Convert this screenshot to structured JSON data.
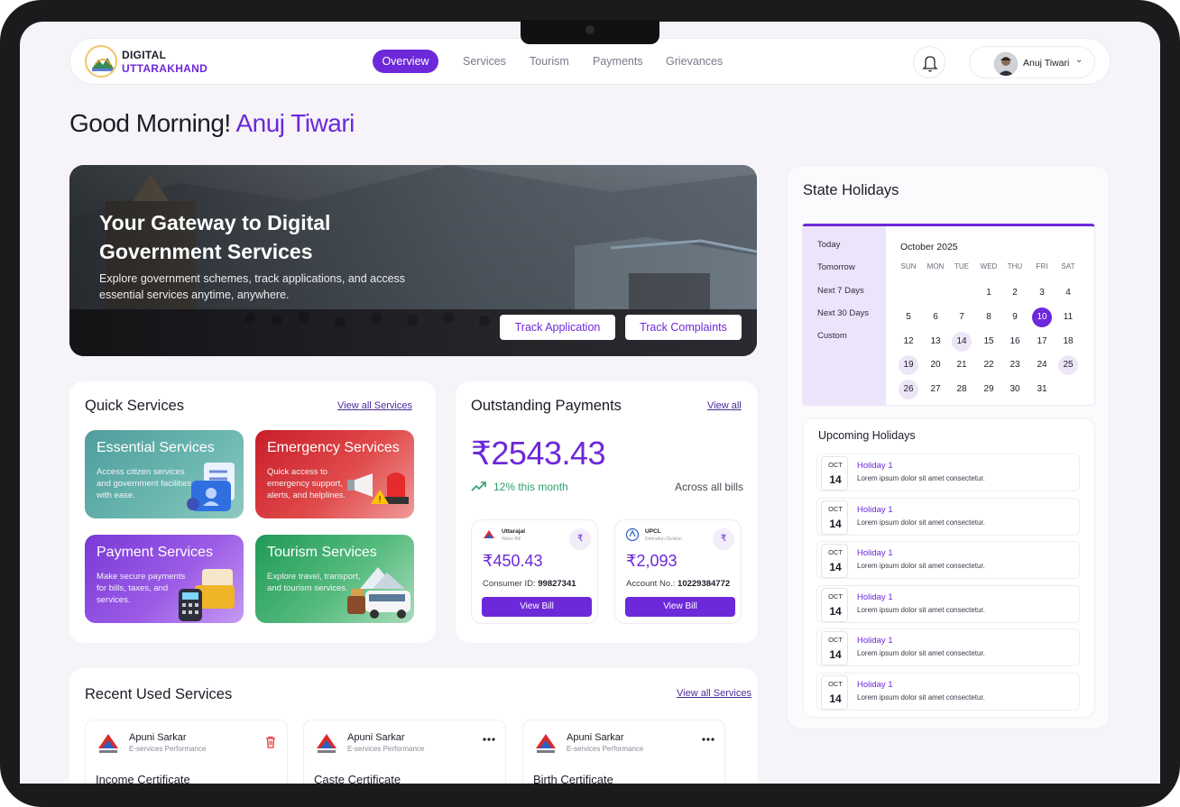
{
  "brand": {
    "line1": "DIGITAL",
    "line2": "UTTARAKHAND"
  },
  "nav": {
    "active": "Overview",
    "items": [
      "Services",
      "Tourism",
      "Payments",
      "Grievances"
    ]
  },
  "user": {
    "name": "Anuj Tiwari"
  },
  "greeting": {
    "prefix": "Good Morning!",
    "name": "Anuj Tiwari"
  },
  "hero": {
    "title": "Your Gateway to Digital Government Services",
    "subtitle": "Explore government schemes, track applications, and access essential services anytime, anywhere.",
    "btn_track_app": "Track Application",
    "btn_track_complaints": "Track Complaints"
  },
  "quick_services": {
    "title": "Quick Services",
    "link": "View all Services",
    "tiles": [
      {
        "title": "Essential Services",
        "desc": "Access citizen services and government facilities with ease."
      },
      {
        "title": "Emergency Services",
        "desc": "Quick access to emergency support, alerts, and helplines."
      },
      {
        "title": "Payment Services",
        "desc": "Make secure payments for bills, taxes, and services."
      },
      {
        "title": "Tourism Services",
        "desc": "Explore travel, transport, and tourism services."
      }
    ]
  },
  "payments": {
    "title": "Outstanding Payments",
    "link": "View all",
    "amount": "₹2543.43",
    "trend": "12% this month",
    "across": "Across all bills",
    "bills": [
      {
        "org": "Uttarajal",
        "org_sub": "Water Bill",
        "amount": "₹450.43",
        "id_label": "Consumer ID:",
        "id_value": "99827341",
        "btn": "View Bill"
      },
      {
        "org": "UPCL",
        "org_sub": "Dehradun Division",
        "amount": "₹2,093",
        "id_label": "Account No.:",
        "id_value": "10229384772",
        "btn": "View Bill"
      }
    ]
  },
  "holidays": {
    "title": "State Holidays",
    "calendar": {
      "options": [
        "Today",
        "Tomorrow",
        "Next 7 Days",
        "Next 30 Days",
        "Custom"
      ],
      "month": "October 2025",
      "dow": [
        "SUN",
        "MON",
        "TUE",
        "WED",
        "THU",
        "FRI",
        "SAT"
      ],
      "selected_day": 10,
      "highlight_days": [
        14,
        19,
        25,
        26
      ]
    },
    "upcoming_title": "Upcoming Holidays",
    "upcoming": [
      {
        "mon": "OCT",
        "day": "14",
        "name": "Holiday 1",
        "desc": "Lorem ipsum dolor sit amet consectetur."
      },
      {
        "mon": "OCT",
        "day": "14",
        "name": "Holiday 1",
        "desc": "Lorem ipsum dolor sit amet consectetur."
      },
      {
        "mon": "OCT",
        "day": "14",
        "name": "Holiday 1",
        "desc": "Lorem ipsum dolor sit amet consectetur."
      },
      {
        "mon": "OCT",
        "day": "14",
        "name": "Holiday 1",
        "desc": "Lorem ipsum dolor sit amet consectetur."
      },
      {
        "mon": "OCT",
        "day": "14",
        "name": "Holiday 1",
        "desc": "Lorem ipsum dolor sit amet consectetur."
      },
      {
        "mon": "OCT",
        "day": "14",
        "name": "Holiday 1",
        "desc": "Lorem ipsum dolor sit amet consectetur."
      }
    ]
  },
  "recent": {
    "title": "Recent Used Services",
    "link": "View all Services",
    "items": [
      {
        "name": "Apuni Sarkar",
        "sub": "E-services Performance",
        "doc": "Income Certificate",
        "action_icon": "trash-icon"
      },
      {
        "name": "Apuni Sarkar",
        "sub": "E-services Performance",
        "doc": "Caste Certificate",
        "action_icon": "more-icon"
      },
      {
        "name": "Apuni Sarkar",
        "sub": "E-services Performance",
        "doc": "Birth Certificate",
        "action_icon": "more-icon"
      }
    ]
  },
  "colors": {
    "accent": "#6d28d9",
    "positive": "#2f9e6a",
    "danger": "#e53935"
  }
}
